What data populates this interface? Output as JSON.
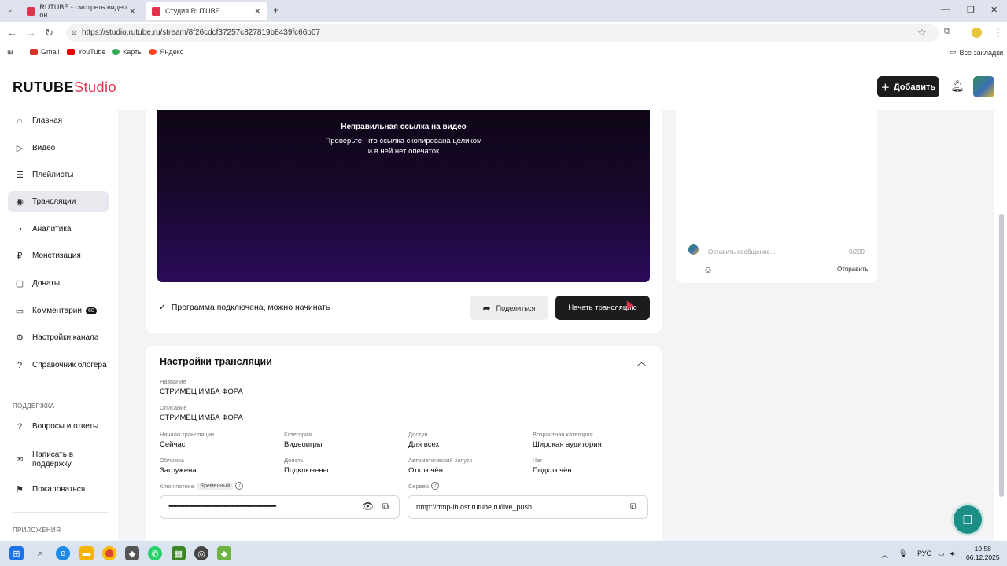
{
  "browser": {
    "tabs": [
      {
        "title": "RUTUBE - смотреть видео он..."
      },
      {
        "title": "Студия RUTUBE"
      }
    ],
    "url": "https://studio.rutube.ru/stream/8f26cdcf37257c827819b8439fc66b07",
    "bookmarks": [
      "Gmail",
      "YouTube",
      "Карты",
      "Яндекс"
    ],
    "all_bookmarks": "Все закладки"
  },
  "header": {
    "logo_main": "RUTUBE",
    "logo_studio": "Studio",
    "add_button": "Добавить"
  },
  "sidebar": {
    "items": [
      {
        "label": "Главная",
        "icon": "home-icon"
      },
      {
        "label": "Видео",
        "icon": "video-icon"
      },
      {
        "label": "Плейлисты",
        "icon": "playlist-icon"
      },
      {
        "label": "Трансляции",
        "icon": "broadcast-icon"
      },
      {
        "label": "Аналитика",
        "icon": "analytics-icon"
      },
      {
        "label": "Монетизация",
        "icon": "monetization-icon"
      },
      {
        "label": "Донаты",
        "icon": "donate-icon"
      },
      {
        "label": "Комментарии",
        "icon": "comments-icon",
        "badge": "60"
      },
      {
        "label": "Настройки канала",
        "icon": "gear-icon"
      },
      {
        "label": "Справочник блогера",
        "icon": "help-book-icon"
      }
    ],
    "support_group": "ПОДДЕРЖКА",
    "support_items": [
      {
        "label": "Вопросы и ответы"
      },
      {
        "label": "Написать в поддержку"
      },
      {
        "label": "Пожаловаться"
      }
    ],
    "apps_group": "ПРИЛОЖЕНИЯ"
  },
  "player": {
    "error_title": "Неправильная ссылка на видео",
    "error_text": "Проверьте, что ссылка скопирована целиком и в ней нет опечаток"
  },
  "stream_status": "Программа подключена, можно начинать",
  "share_button": "Поделиться",
  "start_button": "Начать трансляцию",
  "settings": {
    "title": "Настройки трансляции",
    "name_label": "Название",
    "name_value": "СТРИМЕЦ ИМБА ФОРА",
    "desc_label": "Описание",
    "desc_value": "СТРИМЕЦ ИМБА ФОРА",
    "fields": [
      {
        "label": "Начало трансляции",
        "value": "Сейчас"
      },
      {
        "label": "Категория",
        "value": "Видеоигры"
      },
      {
        "label": "Доступ",
        "value": "Для всех"
      },
      {
        "label": "Возрастная категория",
        "value": "Широкая аудитория"
      },
      {
        "label": "Обложка",
        "value": "Загружена"
      },
      {
        "label": "Донаты",
        "value": "Подключены"
      },
      {
        "label": "Автоматический запуск",
        "value": "Отключён"
      },
      {
        "label": "Чат",
        "value": "Подключён"
      }
    ],
    "stream_key_label": "Ключ потока",
    "stream_key_tag": "Временный",
    "stream_key_mask": "••••••••••••••••••••••••••••••••••••••••••••••••••••••••••••••••••••",
    "server_label": "Сервер",
    "server_value": "rtmp://rtmp-lb.ost.rutube.ru/live_push"
  },
  "chat": {
    "placeholder": "Оставить сообщение...",
    "counter": "0/200",
    "send": "Отправить"
  },
  "taskbar": {
    "lang": "РУС",
    "time": "10:58",
    "date": "06.12.2025"
  },
  "colors": {
    "brand": "#e3324e",
    "dark_button": "#1c1c1f",
    "help_fab": "#1b8f86"
  }
}
